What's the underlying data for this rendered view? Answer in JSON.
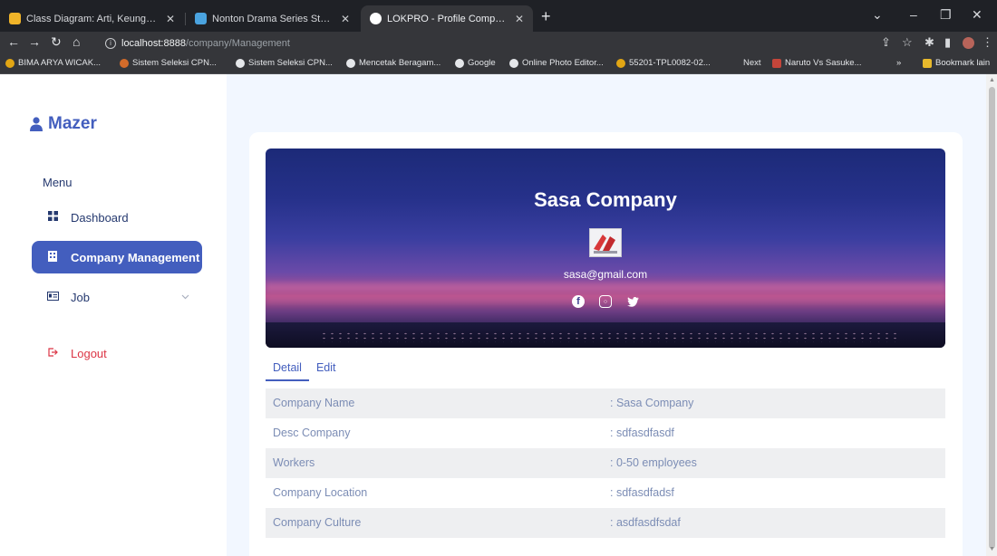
{
  "browser": {
    "tabs": [
      {
        "title": "Class Diagram: Arti, Keunggulan,",
        "active": false
      },
      {
        "title": "Nonton Drama Series Start-Up (S",
        "active": false
      },
      {
        "title": "LOKPRO - Profile Company",
        "active": true
      }
    ],
    "url_host": "localhost:8888",
    "url_path": "/company/Management",
    "bookmarks": [
      "BIMA ARYA WICAK...",
      "Sistem Seleksi CPN...",
      "Sistem Seleksi CPN...",
      "Mencetak Beragam...",
      "Google",
      "Online Photo Editor...",
      "55201-TPL0082-02...",
      "Next",
      "Naruto Vs Sasuke...",
      "Bookmark lain"
    ],
    "overflow": "»"
  },
  "sidebar": {
    "brand": "Mazer",
    "menu_title": "Menu",
    "items": [
      {
        "label": "Dashboard",
        "active": false
      },
      {
        "label": "Company Management",
        "active": true
      },
      {
        "label": "Job",
        "active": false
      }
    ],
    "logout": "Logout"
  },
  "profile": {
    "name": "Sasa Company",
    "email": "sasa@gmail.com"
  },
  "tabs": {
    "detail": "Detail",
    "edit": "Edit"
  },
  "details": [
    {
      "label": "Company Name",
      "value": ": Sasa Company"
    },
    {
      "label": "Desc Company",
      "value": ": sdfasdfasdf"
    },
    {
      "label": "Workers",
      "value": ": 0-50 employees"
    },
    {
      "label": "Company Location",
      "value": ": sdfasdfadsf"
    },
    {
      "label": "Company Culture",
      "value": ": asdfasdfsdaf"
    }
  ],
  "colors": {
    "primary": "#435ebe",
    "text": "#25396f",
    "muted": "#7c8db5",
    "logout": "#dc3545",
    "background": "#f2f7ff"
  },
  "icons": [
    "user-icon",
    "grid-icon",
    "building-icon",
    "card-icon",
    "chevron-down-icon",
    "logout-icon",
    "facebook-icon",
    "instagram-icon",
    "twitter-icon"
  ]
}
